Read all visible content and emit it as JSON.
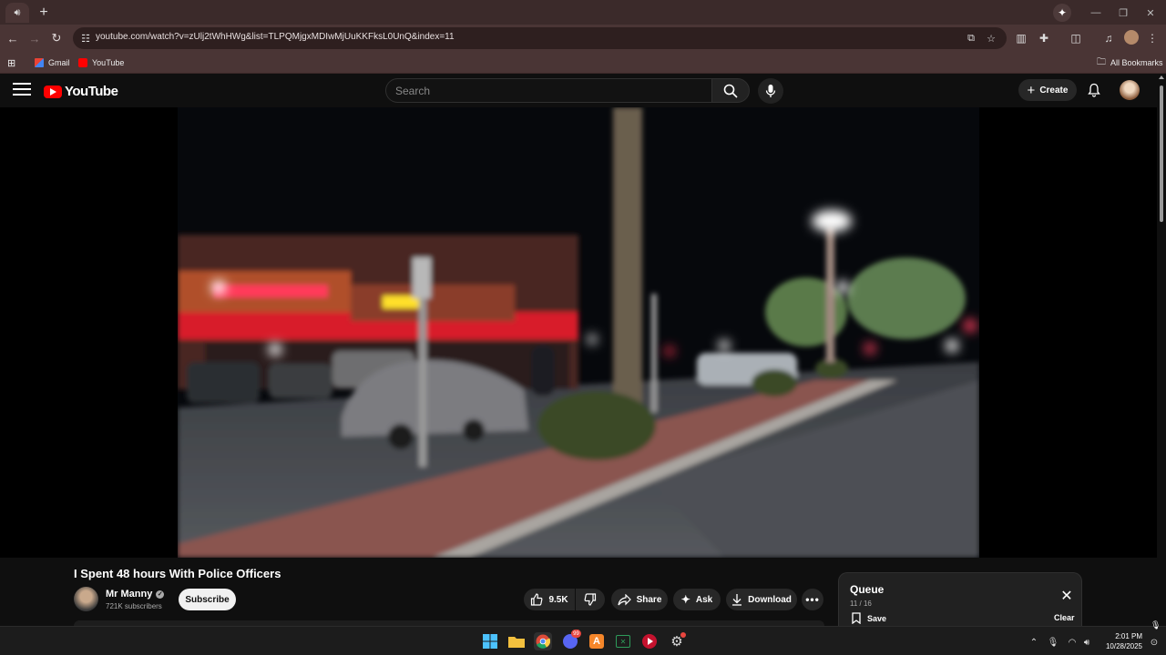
{
  "browser": {
    "url": "youtube.com/watch?v=zUlj2tWhHWg&list=TLPQMjgxMDIwMjUuKKFksL0UnQ&index=11",
    "bookmarks": [
      "Gmail",
      "YouTube"
    ],
    "all_bookmarks_label": "All Bookmarks"
  },
  "header": {
    "logo_text": "YouTube",
    "search_placeholder": "Search",
    "create_label": "Create"
  },
  "video": {
    "title": "I Spent 48 hours With Police Officers",
    "channel_name": "Mr Manny",
    "subscribers": "721K subscribers",
    "subscribe_label": "Subscribe",
    "likes": "9.5K",
    "share_label": "Share",
    "ask_label": "Ask",
    "download_label": "Download"
  },
  "queue": {
    "title": "Queue",
    "counter": "11 / 16",
    "save_label": "Save",
    "clear_label": "Clear"
  },
  "taskbar": {
    "time": "2:01 PM",
    "date": "10/28/2025",
    "discord_badge": "99"
  },
  "colors": {
    "yt_red": "#ff0000",
    "chrome_frame": "#4a3535",
    "background": "#0f0f0f"
  }
}
